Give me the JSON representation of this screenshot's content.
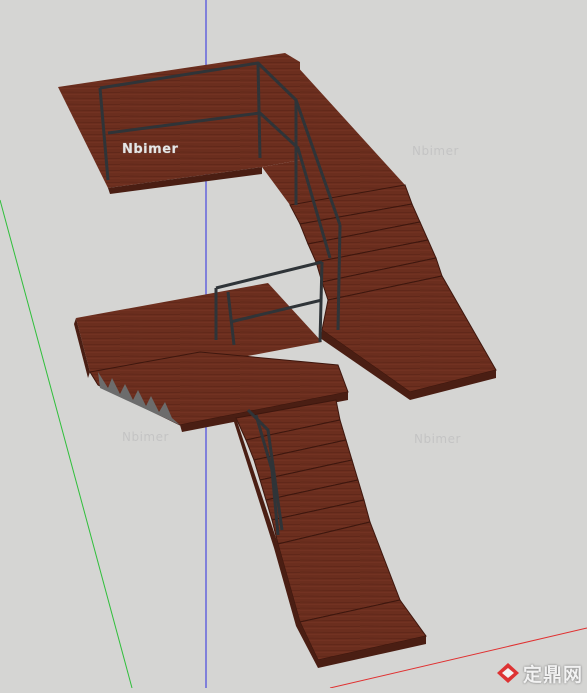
{
  "scene": {
    "model": "staircase",
    "colors": {
      "background": "#d5d5d3",
      "wood_top": "#6b2e1e",
      "wood_front": "#4a1e13",
      "railing": "#2f3438",
      "axis_blue": "#2a2ae0",
      "axis_green": "#2fbf3a",
      "axis_red": "#e03030"
    }
  },
  "watermarks": {
    "main": "Nbimer",
    "repeat": "Nbimer"
  },
  "brand": {
    "text": "定鼎网",
    "icon": "diamond-logo-icon"
  }
}
